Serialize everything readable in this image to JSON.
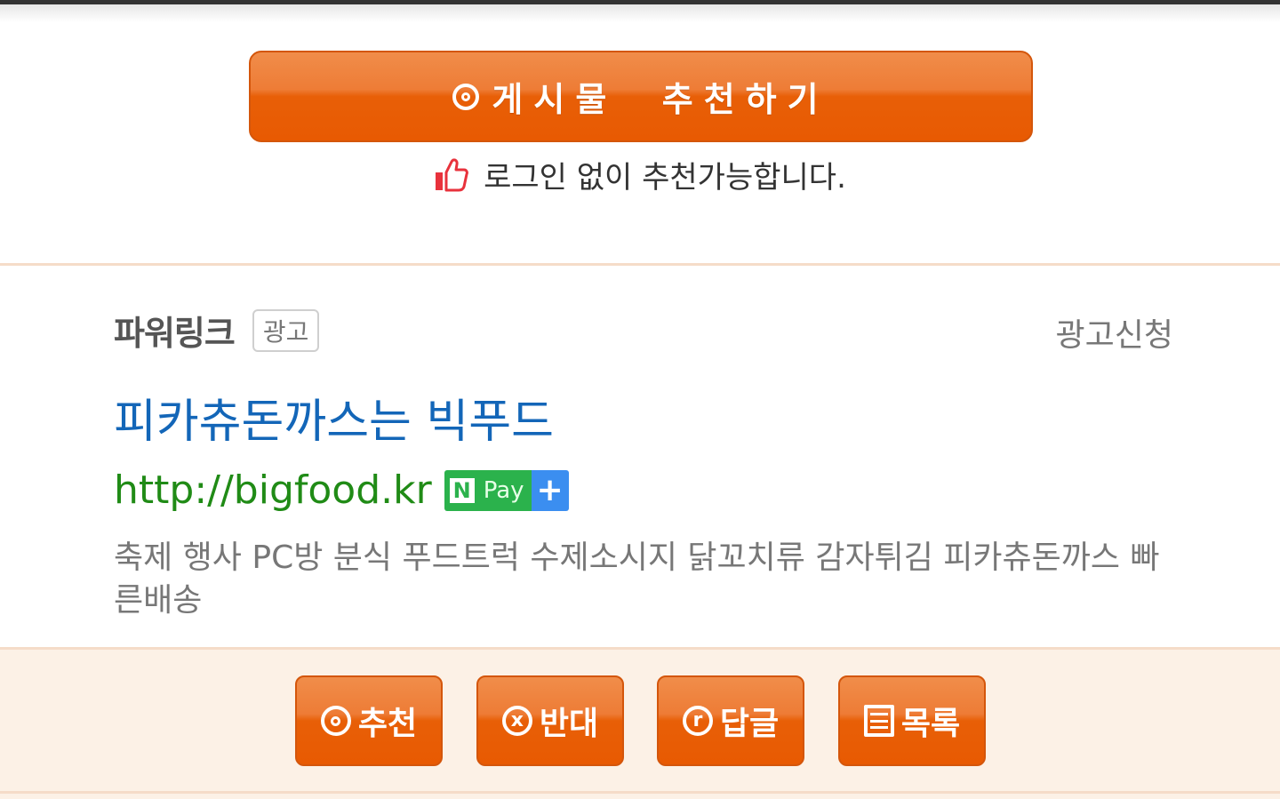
{
  "recommend_button": {
    "label": "게시물  추천하기",
    "icon": "circle-target-icon"
  },
  "login_note": {
    "text": "로그인 없이 추천가능합니다.",
    "icon": "thumbs-up-icon"
  },
  "ad": {
    "section_title": "파워링크",
    "badge": "광고",
    "apply_link": "광고신청",
    "title": "피카츄돈까스는 빅푸드",
    "url": "http://bigfood.kr",
    "npay": {
      "n": "N",
      "pay": "Pay",
      "plus": "+"
    },
    "description": "축제 행사 PC방 분식 푸드트럭 수제소시지 닭꼬치류 감자튀김 피카츄돈까스 빠른배송"
  },
  "actions": [
    {
      "label": "추천",
      "icon": "circle-target-icon"
    },
    {
      "label": "반대",
      "icon": "circle-x-icon",
      "glyph": "x"
    },
    {
      "label": "답글",
      "icon": "circle-r-icon",
      "glyph": "r"
    },
    {
      "label": "목록",
      "icon": "list-icon"
    }
  ],
  "colors": {
    "button_orange": "#e85f07",
    "ad_title_blue": "#1366b8",
    "ad_url_green": "#208b16",
    "bottom_bg": "#fcf1e6"
  }
}
